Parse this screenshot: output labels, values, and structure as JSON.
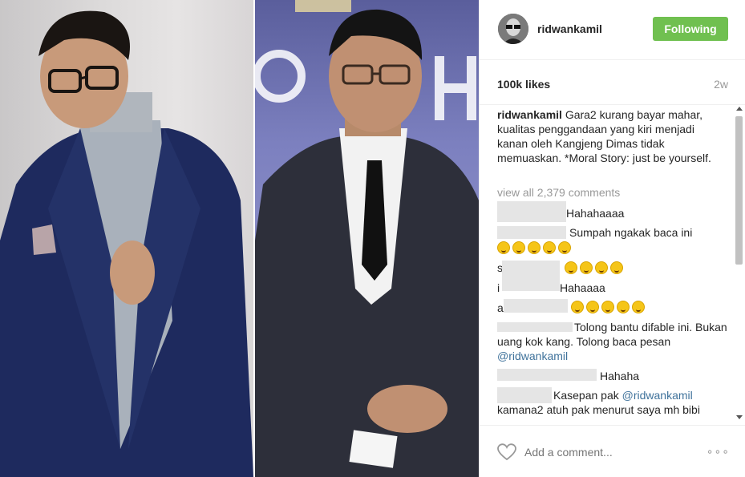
{
  "post": {
    "username": "ridwankamil",
    "follow_label": "Following",
    "follow_color": "#70c050",
    "likes": "100k likes",
    "age": "2w",
    "caption_user": "ridwankamil",
    "caption_text": "Gara2 kurang bayar mahar, kualitas penggandaan yang kiri menjadi kanan oleh Kangjeng Dimas tidak memuaskan. *Moral Story: just be yourself.",
    "view_all": "view all 2,379 comments",
    "add_comment_placeholder": "Add a comment...",
    "more_label": "∘∘∘"
  },
  "comments": [
    {
      "text": "Hahahaaaa"
    },
    {
      "text": "Sumpah ngakak baca ini"
    },
    {
      "text": "s",
      "emoji_count": 4
    },
    {
      "text": "i",
      "text2": "Hahaaaa"
    },
    {
      "text": "a",
      "emoji_count": 5
    },
    {
      "text": "Tolong bantu difable ini. Bukan uang kok kang. Tolong baca pesan",
      "mention": "@ridwankamil"
    },
    {
      "text": "Hahaha"
    },
    {
      "text": "Kasepan pak",
      "mention": "@ridwankamil",
      "text2": "kamana2 atuh pak menurut saya mh bibi"
    }
  ],
  "icons": {
    "heart": "heart-icon",
    "more": "more-options-icon",
    "emoji": "laughing-emoji-icon"
  }
}
